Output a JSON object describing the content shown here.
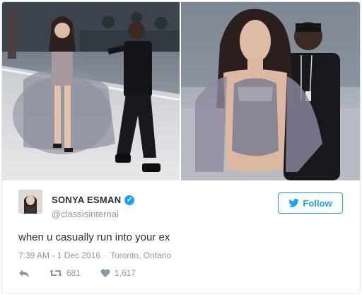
{
  "author": {
    "name": "SONYA ESMAN",
    "handle": "@classisinternal",
    "verified_icon": "verified-check-icon"
  },
  "follow_button": {
    "label": "Follow",
    "icon": "twitter-bird-icon"
  },
  "tweet": {
    "text": "when u casually run into your ex",
    "time": "7:39 AM - 1 Dec 2016",
    "separator": "·",
    "location": "Toronto, Ontario"
  },
  "actions": {
    "reply_icon": "reply-icon",
    "retweet_icon": "retweet-icon",
    "retweets": "681",
    "like_icon": "heart-icon",
    "likes": "1,617"
  },
  "colors": {
    "accent": "#1da1f2",
    "text": "#292f33",
    "muted": "#8899a6",
    "border": "#e1e8ed"
  }
}
